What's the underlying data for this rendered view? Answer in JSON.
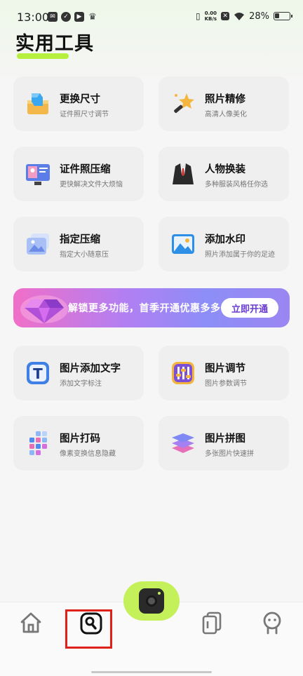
{
  "status_bar": {
    "time": "13:00",
    "net_speed_value": "0.00",
    "net_speed_unit": "KB/s",
    "battery": "28%"
  },
  "page": {
    "title": "实用工具"
  },
  "tools": [
    {
      "title": "更换尺寸",
      "subtitle": "证件照尺寸调节",
      "icon": "cube-ruler-icon"
    },
    {
      "title": "照片精修",
      "subtitle": "高清人像美化",
      "icon": "magic-wand-icon"
    },
    {
      "title": "证件照压缩",
      "subtitle": "更快解决文件大烦恼",
      "icon": "monitor-id-photo-icon"
    },
    {
      "title": "人物换装",
      "subtitle": "多种服装风格任你选",
      "icon": "suit-icon"
    },
    {
      "title": "指定压缩",
      "subtitle": "指定大小随意压",
      "icon": "image-stack-icon"
    },
    {
      "title": "添加水印",
      "subtitle": "照片添加属于你的足迹",
      "icon": "landscape-image-icon"
    },
    {
      "title": "图片添加文字",
      "subtitle": "添加文字标注",
      "icon": "text-t-icon"
    },
    {
      "title": "图片调节",
      "subtitle": "图片参数调节",
      "icon": "sliders-icon"
    },
    {
      "title": "图片打码",
      "subtitle": "像素变换信息隐藏",
      "icon": "mosaic-icon"
    },
    {
      "title": "图片拼图",
      "subtitle": "多张图片快速拼",
      "icon": "layers-icon"
    }
  ],
  "banner": {
    "text": "解锁更多功能，首季开通优惠多多",
    "button": "立即开通"
  },
  "nav": {
    "items": [
      "home-icon",
      "tools-icon",
      "camera-icon",
      "album-icon",
      "profile-icon"
    ]
  },
  "colors": {
    "accent": "#b7ef3f",
    "camera_fab": "#c4f05a",
    "highlight": "#e0201a",
    "banner_start": "#f06fc8",
    "banner_end": "#9b86f2"
  }
}
